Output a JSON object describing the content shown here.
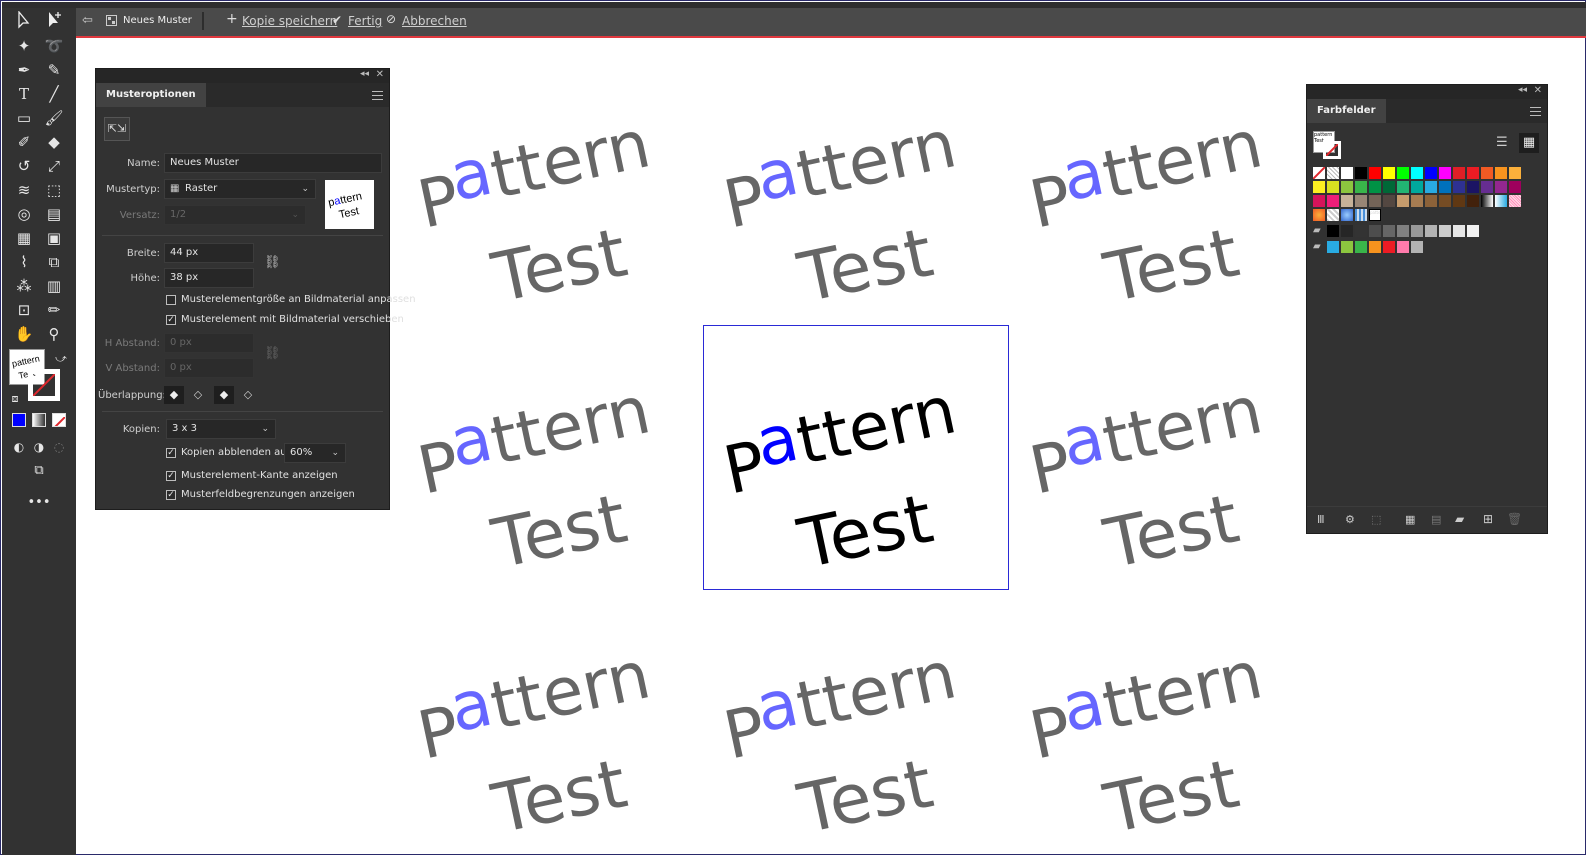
{
  "topbar": {
    "back_icon": "back-arrow-icon",
    "pattern_name": "Neues Muster",
    "save_copy": "Kopie speichern",
    "done": "Fertig",
    "cancel": "Abbrechen"
  },
  "musteroptionen": {
    "title": "Musteroptionen",
    "name_label": "Name:",
    "name_value": "Neues Muster",
    "type_label": "Mustertyp:",
    "type_value": "Raster",
    "offset_label": "Versatz:",
    "offset_value": "1/2",
    "width_label": "Breite:",
    "width_value": "44 px",
    "height_label": "Höhe:",
    "height_value": "38 px",
    "cb_resize": "Musterelementgröße an Bildmaterial anpassen",
    "cb_move": "Musterelement mit Bildmaterial verschieben",
    "h_spacing_label": "H Abstand:",
    "h_spacing_value": "0 px",
    "v_spacing_label": "V Abstand:",
    "v_spacing_value": "0 px",
    "overlap_label": "Überlappung:",
    "copies_label": "Kopien:",
    "copies_value": "3 x 3",
    "dim_copies_label": "Kopien abblenden auf:",
    "dim_copies_value": "60%",
    "cb_edge": "Musterelement-Kante anzeigen",
    "cb_bounds": "Musterfeldbegrenzungen anzeigen",
    "cb_resize_checked": false,
    "cb_move_checked": true,
    "cb_dim_checked": true,
    "cb_edge_checked": true,
    "cb_bounds_checked": true
  },
  "farbfelder": {
    "title": "Farbfelder",
    "rows": [
      [
        "none",
        "reg",
        "#ffffff",
        "#000000",
        "#ff0000",
        "#ffff00",
        "#00ff00",
        "#00ffff",
        "#0000ff",
        "#ff00ff",
        "#e01f26",
        "#ec1c24",
        "#f15a24",
        "#f7931e",
        "#fbb03b"
      ],
      [
        "#fcee21",
        "#d9e021",
        "#8cc63f",
        "#39b54a",
        "#009245",
        "#006837",
        "#22b573",
        "#00a99d",
        "#29abe2",
        "#0071bc",
        "#2e3192",
        "#1b1464",
        "#662d91",
        "#93278f",
        "#9e005d"
      ],
      [
        "#d4145a",
        "#ed1e79",
        "#c7b299",
        "#998675",
        "#736357",
        "#534741",
        "#c69c6d",
        "#a67c52",
        "#8c6239",
        "#754c24",
        "#603813",
        "#42210b",
        "grad1",
        "grad2",
        "grad3"
      ],
      [
        "grad4",
        "pat1",
        "pat2",
        "pat3",
        "pat4"
      ],
      [
        "folder",
        "#000000",
        "#262626",
        "#333333",
        "#4d4d4d",
        "#666666",
        "#808080",
        "#999999",
        "#b3b3b3",
        "#cccccc",
        "#e6e6e6",
        "#f2f2f2"
      ],
      [
        "folder",
        "#29abe2",
        "#8cc63f",
        "#39b54a",
        "#f7931e",
        "#ed1c24",
        "#ff7bac",
        "#b3b3b3"
      ]
    ]
  },
  "pattern": {
    "word1_rest": "ttern",
    "word1_p": "P",
    "word1_a": "a",
    "word2": "Test",
    "a_color": "#0000ff",
    "a_color_dim": "#6666ff",
    "text_color": "#000000",
    "text_color_dim": "#666666"
  },
  "thumbnail": {
    "line1": "pattern",
    "line2": "Test"
  }
}
